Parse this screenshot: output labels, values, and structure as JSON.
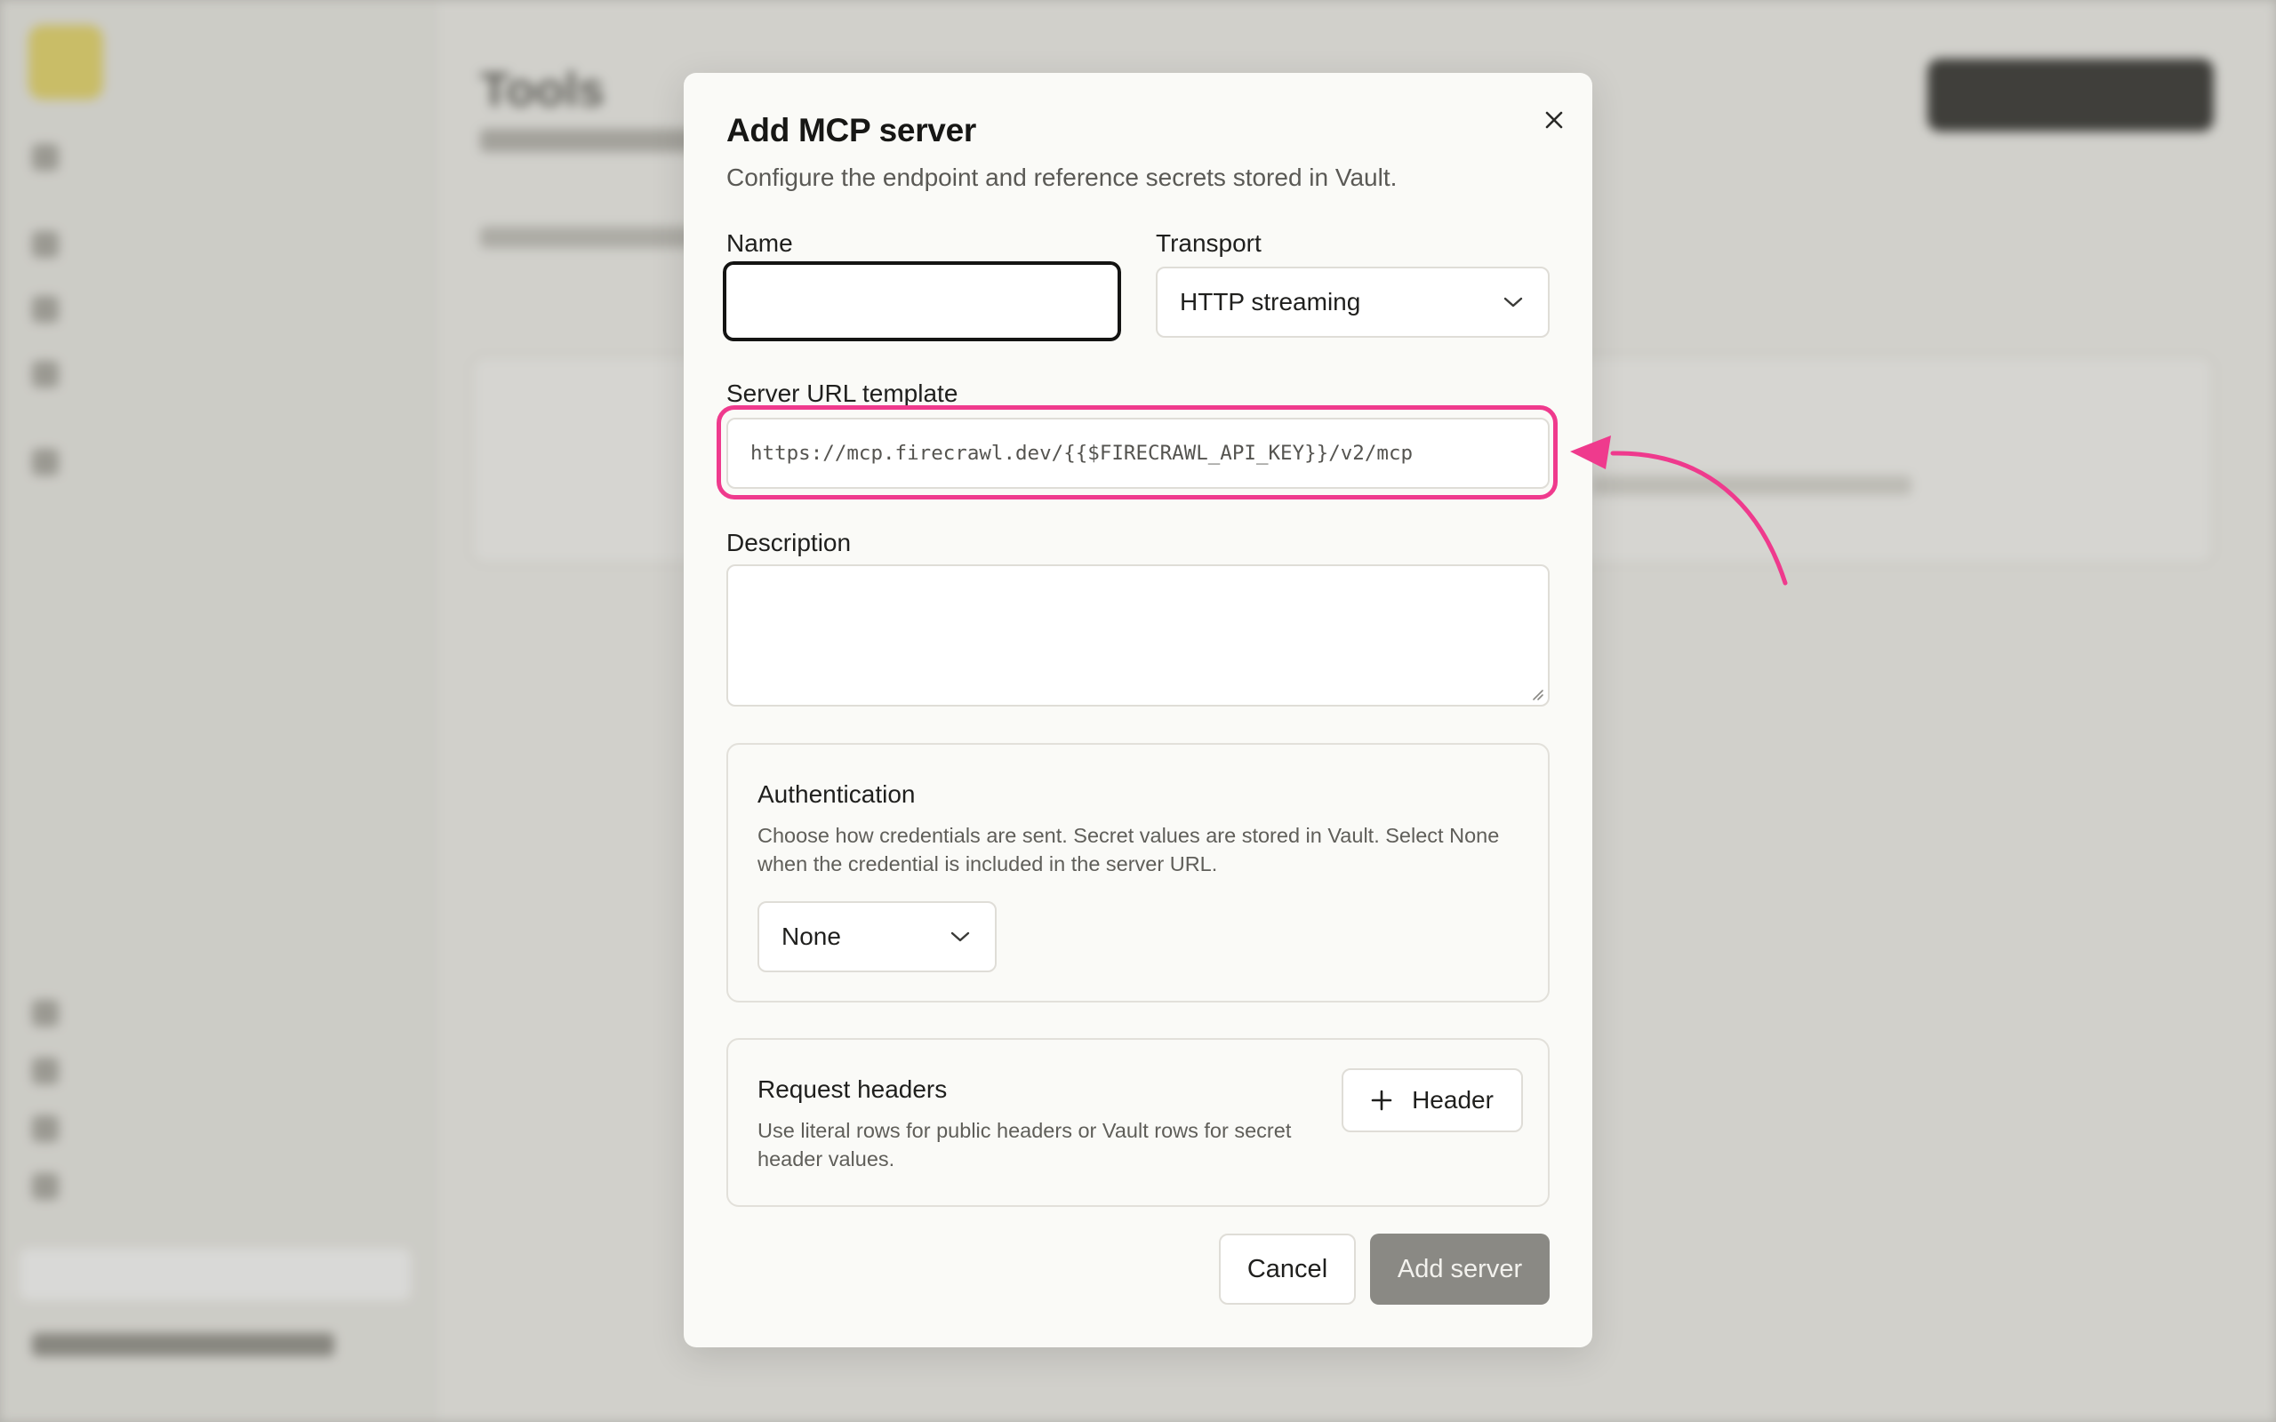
{
  "background": {
    "page_title": "Tools"
  },
  "modal": {
    "title": "Add MCP server",
    "description": "Configure the endpoint and reference secrets stored in Vault.",
    "name": {
      "label": "Name",
      "value": "",
      "placeholder": ""
    },
    "transport": {
      "label": "Transport",
      "selected": "HTTP streaming"
    },
    "server_url": {
      "label": "Server URL template",
      "value": "https://mcp.firecrawl.dev/{{$FIRECRAWL_API_KEY}}/v2/mcp"
    },
    "description_field": {
      "label": "Description",
      "value": ""
    },
    "authentication": {
      "title": "Authentication",
      "description_line1": "Choose how credentials are sent. Secret values are stored in Vault. Select None",
      "description_line2": "when the credential is included in the server URL.",
      "selected": "None"
    },
    "request_headers": {
      "title": "Request headers",
      "description_line1": "Use literal rows for public headers or Vault rows for secret",
      "description_line2": "header values.",
      "add_button_label": "Header"
    },
    "cancel_label": "Cancel",
    "submit_label": "Add server"
  },
  "annotation": {
    "highlight_color": "#ef3a8d"
  }
}
